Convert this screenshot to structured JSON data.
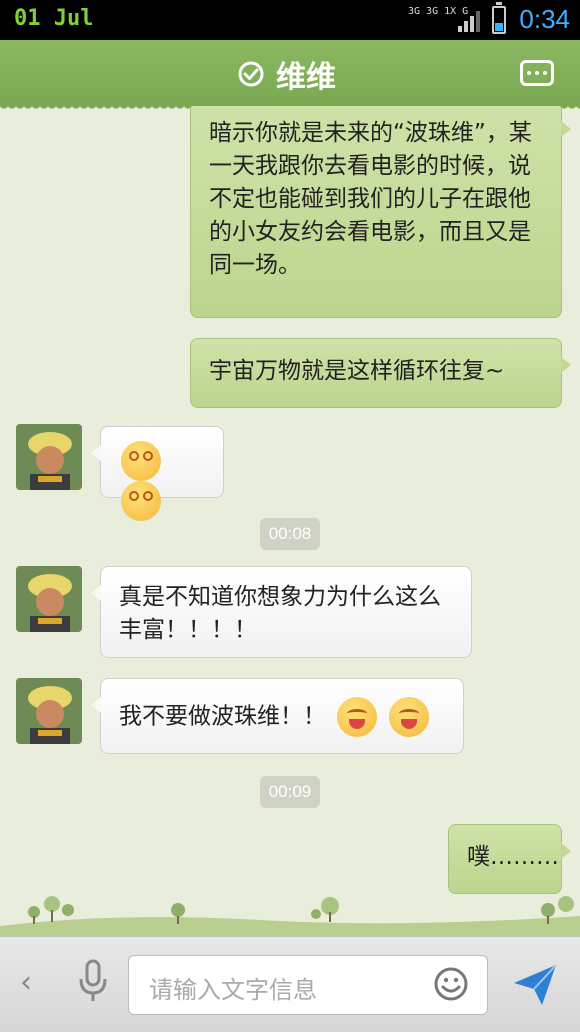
{
  "status_bar": {
    "date": "01 Jul",
    "network": "3G 3G 1X G",
    "time": "0:34"
  },
  "header": {
    "title": "维维",
    "verified_icon": "check-circle-icon",
    "more_icon": "more-dots-icon"
  },
  "messages": [
    {
      "side": "right",
      "text": "暗示你就是未来的“波珠维”，某一天我跟你去看电影的时候，说不定也能碰到我们的儿子在跟他的小女友约会看电影，而且又是同一场。"
    },
    {
      "side": "right",
      "text": "宇宙万物就是这样循环往复~"
    },
    {
      "side": "left",
      "emojis": [
        "dizzy-face-emoji",
        "dizzy-face-emoji"
      ]
    },
    {
      "type": "time",
      "text": "00:08"
    },
    {
      "side": "left",
      "text": "真是不知道你想象力为什么这么丰富！！！！"
    },
    {
      "side": "left",
      "text": "我不要做波珠维！！",
      "emojis": [
        "crying-face-emoji",
        "crying-face-emoji"
      ]
    },
    {
      "type": "time",
      "text": "00:09"
    },
    {
      "side": "right",
      "text": "噗………"
    }
  ],
  "input_bar": {
    "placeholder": "请输入文字信息",
    "back_icon": "chevron-left-icon",
    "voice_icon": "microphone-icon",
    "emoji_icon": "smiley-icon",
    "send_icon": "send-arrow-icon"
  },
  "colors": {
    "header_green": "#7aa852",
    "sent_bubble": "#c2d996",
    "received_bubble": "#ffffff",
    "chat_background": "#e9eddc",
    "time_accent": "#3fb0ff"
  }
}
